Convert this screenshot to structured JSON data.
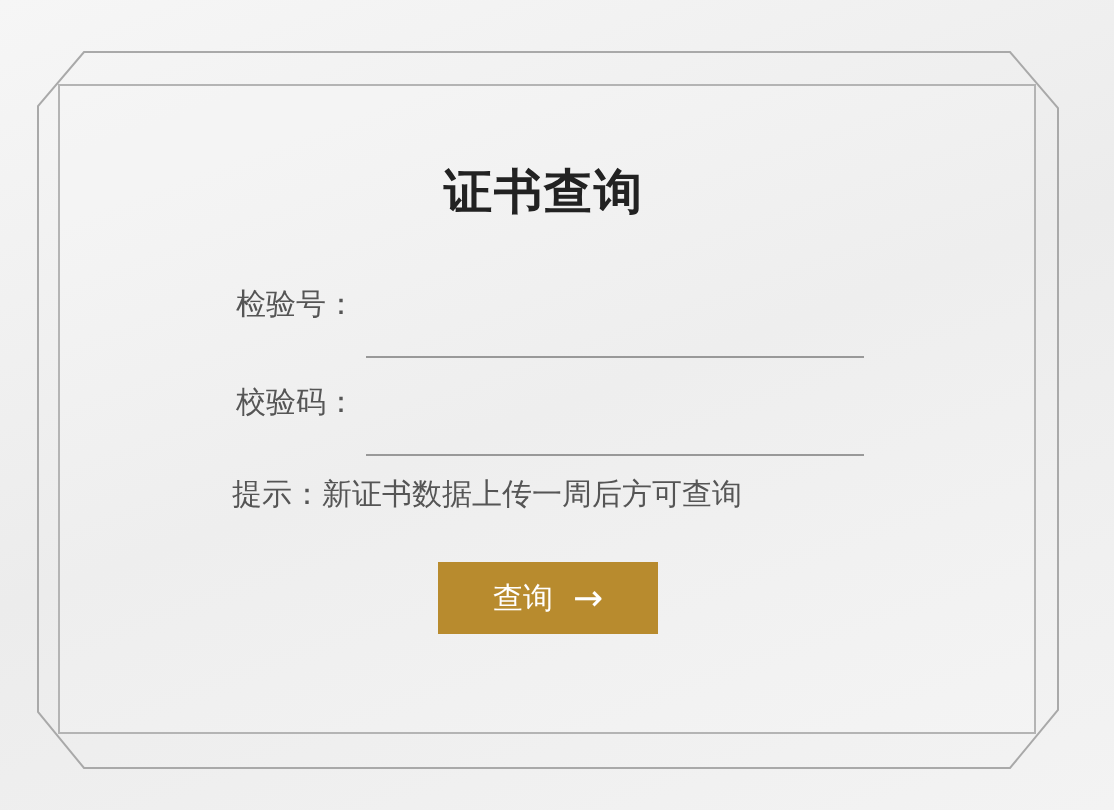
{
  "title": "证书查询",
  "fields": [
    {
      "label": "检验号："
    },
    {
      "label": "校验码："
    }
  ],
  "hint": "提示：新证书数据上传一周后方可查询",
  "button": {
    "label": "查询",
    "arrow": "→"
  }
}
